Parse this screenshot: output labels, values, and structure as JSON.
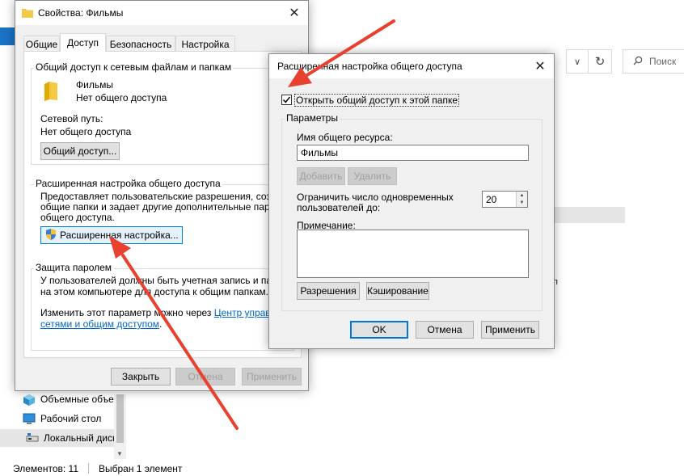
{
  "explorer": {
    "search_placeholder": "Поиск",
    "refresh_glyph": "↻",
    "chevron_glyph": "∨",
    "list_fragment": "п",
    "sidebar_items": [
      {
        "label": "Объемные объекты",
        "icon": "3d-objects-icon"
      },
      {
        "label": "Рабочий стол",
        "icon": "desktop-icon"
      },
      {
        "label": "Локальный диск",
        "icon": "local-disk-icon"
      }
    ],
    "status_items_count": "Элементов: 11",
    "status_selected": "Выбран 1 элемент"
  },
  "properties_dialog": {
    "title": "Свойства: Фильмы",
    "tabs": [
      {
        "label": "Общие",
        "active": false
      },
      {
        "label": "Доступ",
        "active": true
      },
      {
        "label": "Безопасность",
        "active": false
      },
      {
        "label": "Настройка",
        "active": false
      }
    ],
    "network_group": {
      "legend": "Общий доступ к сетевым файлам и папкам",
      "folder_name": "Фильмы",
      "folder_status": "Нет общего доступа",
      "network_path_label": "Сетевой путь:",
      "network_path_value": "Нет общего доступа",
      "share_button": "Общий доступ..."
    },
    "advanced_group": {
      "legend": "Расширенная настройка общего доступа",
      "description": [
        "Предоставляет пользовательские разрешения, создает",
        "общие папки и задает другие дополнительные параметры",
        "общего доступа."
      ],
      "button": "Расширенная настройка..."
    },
    "password_group": {
      "legend": "Защита паролем",
      "description": [
        "У пользователей должны быть учетная запись и пароль",
        "на этом компьютере для доступа к общим папкам."
      ],
      "change_text": "Изменить этот параметр можно через",
      "link_line1": "Центр управления",
      "link_line2": "сетями и общим доступом",
      "link_end": "."
    },
    "buttons": {
      "close": "Закрыть",
      "cancel": "Отмена",
      "apply": "Применить"
    }
  },
  "advanced_dialog": {
    "title": "Расширенная настройка общего доступа",
    "share_checkbox_label": "Открыть общий доступ к этой папке",
    "share_checked": true,
    "params_legend": "Параметры",
    "share_name_label": "Имя общего ресурса:",
    "share_name_value": "Фильмы",
    "add_button": "Добавить",
    "remove_button": "Удалить",
    "limit_label_line1": "Ограничить число одновременных",
    "limit_label_line2": "пользователей до:",
    "limit_value": "20",
    "comment_label": "Примечание:",
    "comment_value": "",
    "permissions_button": "Разрешения",
    "caching_button": "Кэширование",
    "ok_button": "OK",
    "cancel_button": "Отмена",
    "apply_button": "Применить"
  },
  "colors": {
    "accent": "#0078d7",
    "annotation_arrow": "#e8412f",
    "folder": "#f2c94c",
    "link": "#0066cc"
  }
}
